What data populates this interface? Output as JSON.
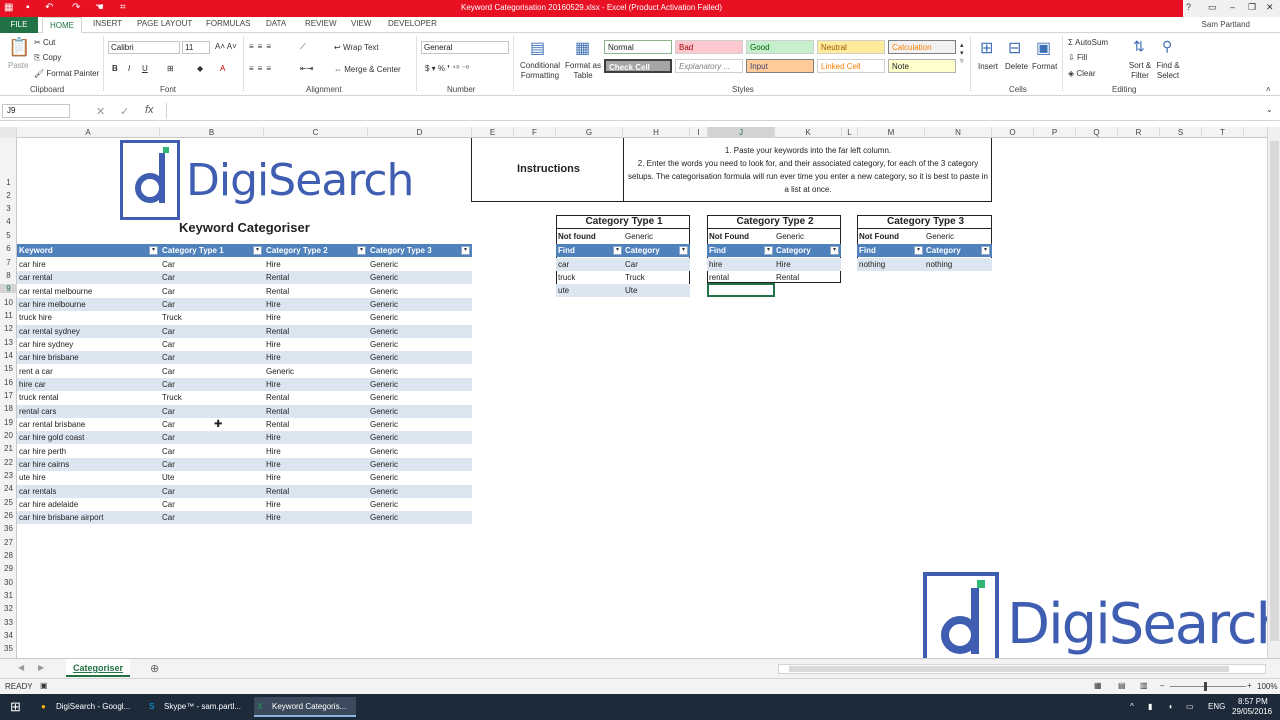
{
  "window": {
    "title": "Keyword Categorisation 20160529.xlsx -  Excel (Product Activation Failed)",
    "user": "Sam Partland"
  },
  "tabs": [
    "FILE",
    "HOME",
    "INSERT",
    "PAGE LAYOUT",
    "FORMULAS",
    "DATA",
    "REVIEW",
    "VIEW",
    "DEVELOPER"
  ],
  "ribbon": {
    "clipboard": {
      "paste": "Paste",
      "cut": "Cut",
      "copy": "Copy",
      "format_painter": "Format Painter",
      "label": "Clipboard"
    },
    "font": {
      "name": "Calibri",
      "size": "11",
      "label": "Font"
    },
    "alignment": {
      "wrap": "Wrap Text",
      "merge": "Merge & Center",
      "label": "Alignment"
    },
    "number": {
      "format": "General",
      "label": "Number"
    },
    "styles": {
      "cond": "Conditional Formatting",
      "table": "Format as Table",
      "normal": "Normal",
      "bad": "Bad",
      "good": "Good",
      "neutral": "Neutral",
      "calculation": "Calculation",
      "check": "Check Cell",
      "explanatory": "Explanatory ...",
      "input": "Input",
      "linked": "Linked Cell",
      "note": "Note",
      "label": "Styles"
    },
    "cells": {
      "insert": "Insert",
      "delete": "Delete",
      "format": "Format",
      "label": "Cells"
    },
    "editing": {
      "autosum": "AutoSum",
      "fill": "Fill",
      "clear": "Clear",
      "sort": "Sort & Filter",
      "find": "Find & Select",
      "label": "Editing"
    }
  },
  "formula_bar": {
    "name_box": "J9",
    "fx": "fx"
  },
  "columns": [
    "A",
    "B",
    "C",
    "D",
    "E",
    "F",
    "G",
    "H",
    "I",
    "J",
    "K",
    "L",
    "M",
    "N",
    "O",
    "P",
    "Q",
    "R",
    "S",
    "T"
  ],
  "rows": [
    "1",
    "2",
    "3",
    "4",
    "5",
    "6",
    "7",
    "8",
    "9",
    "10",
    "11",
    "12",
    "13",
    "14",
    "15",
    "16",
    "17",
    "18",
    "19",
    "20",
    "21",
    "22",
    "23",
    "24",
    "25",
    "26",
    "27",
    "28",
    "29",
    "30",
    "31",
    "32",
    "33",
    "34",
    "35",
    "36"
  ],
  "logo": {
    "text": "DigiSearch"
  },
  "main_title": "Keyword Categoriser",
  "instructions": {
    "label": "Instructions",
    "text": "1. Paste your keywords into the far left column.\n2. Enter the words you need to look for, and their associated category, for each of the 3 category setups. The categorisation formula will run ever time you enter a new category, so it is best to paste in a list at once."
  },
  "table": {
    "headers": [
      "Keyword",
      "Category Type 1",
      "Category Type 2",
      "Category Type 3"
    ],
    "rows": [
      [
        "car hire",
        "Car",
        "Hire",
        "Generic"
      ],
      [
        "car rental",
        "Car",
        "Rental",
        "Generic"
      ],
      [
        "car rental melbourne",
        "Car",
        "Rental",
        "Generic"
      ],
      [
        "car hire melbourne",
        "Car",
        "Hire",
        "Generic"
      ],
      [
        "truck hire",
        "Truck",
        "Hire",
        "Generic"
      ],
      [
        "car rental sydney",
        "Car",
        "Rental",
        "Generic"
      ],
      [
        "car hire sydney",
        "Car",
        "Hire",
        "Generic"
      ],
      [
        "car hire brisbane",
        "Car",
        "Hire",
        "Generic"
      ],
      [
        "rent a car",
        "Car",
        "Generic",
        "Generic"
      ],
      [
        "hire car",
        "Car",
        "Hire",
        "Generic"
      ],
      [
        "truck rental",
        "Truck",
        "Rental",
        "Generic"
      ],
      [
        "rental cars",
        "Car",
        "Rental",
        "Generic"
      ],
      [
        "car rental brisbane",
        "Car",
        "Rental",
        "Generic"
      ],
      [
        "car hire gold coast",
        "Car",
        "Hire",
        "Generic"
      ],
      [
        "car hire perth",
        "Car",
        "Hire",
        "Generic"
      ],
      [
        "car hire cairns",
        "Car",
        "Hire",
        "Generic"
      ],
      [
        "ute hire",
        "Ute",
        "Hire",
        "Generic"
      ],
      [
        "car rentals",
        "Car",
        "Rental",
        "Generic"
      ],
      [
        "car hire adelaide",
        "Car",
        "Hire",
        "Generic"
      ],
      [
        "car hire brisbane airport",
        "Car",
        "Hire",
        "Generic"
      ]
    ]
  },
  "cat1": {
    "title": "Category Type 1",
    "nf_label": "Not found",
    "nf_value": "Generic",
    "h1": "Find",
    "h2": "Category",
    "rows": [
      [
        "car",
        "Car"
      ],
      [
        "truck",
        "Truck"
      ],
      [
        "ute",
        "Ute"
      ]
    ]
  },
  "cat2": {
    "title": "Category Type 2",
    "nf_label": "Not Found",
    "nf_value": "Generic",
    "h1": "Find",
    "h2": "Category",
    "rows": [
      [
        "hire",
        "Hire"
      ],
      [
        "rental",
        "Rental"
      ]
    ]
  },
  "cat3": {
    "title": "Category Type 3",
    "nf_label": "Not Found",
    "nf_value": "Generic",
    "h1": "Find",
    "h2": "Category",
    "rows": [
      [
        "nothing",
        "nothing"
      ]
    ]
  },
  "sheet_tab": "Categoriser",
  "status": {
    "ready": "READY",
    "zoom": "100%"
  },
  "taskbar": {
    "items": [
      "DigiSearch - Googl...",
      "Skype™ - sam.partl...",
      "Keyword Categoris..."
    ],
    "lang": "ENG",
    "time": "8:57 PM",
    "date": "29/05/2016"
  }
}
